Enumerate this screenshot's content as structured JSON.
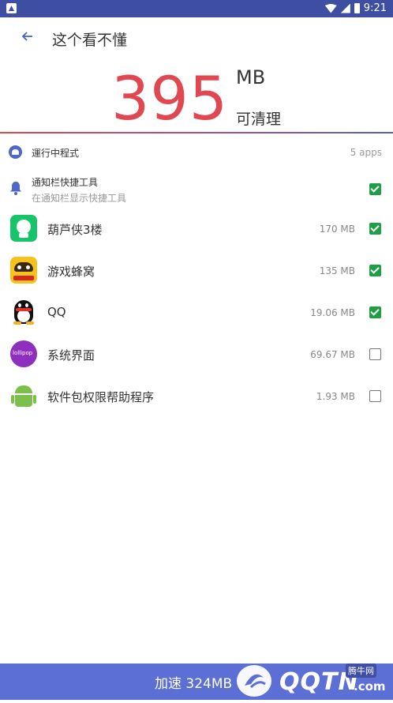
{
  "status": {
    "time": "9:21"
  },
  "header": {
    "title": "这个看不懂"
  },
  "summary": {
    "amount": "395",
    "unit": "MB",
    "label": "可清理"
  },
  "running": {
    "label": "運行中程式",
    "count": "5 apps"
  },
  "notify": {
    "title": "通知栏快捷工具",
    "subtitle": "在通知栏显示快捷工具",
    "checked": true
  },
  "apps": [
    {
      "name": "葫芦侠3楼",
      "size": "170 MB",
      "checked": true,
      "icon": "huluxia-icon"
    },
    {
      "name": "游戏蜂窝",
      "size": "135 MB",
      "checked": true,
      "icon": "youxifengwo-icon"
    },
    {
      "name": "QQ",
      "size": "19.06 MB",
      "checked": true,
      "icon": "qq-penguin-icon"
    },
    {
      "name": "系统界面",
      "size": "69.67 MB",
      "checked": false,
      "icon": "lollipop-icon"
    },
    {
      "name": "软件包权限帮助程序",
      "size": "1.93 MB",
      "checked": false,
      "icon": "android-icon"
    }
  ],
  "footer": {
    "action": "加速 324MB"
  },
  "watermark": {
    "brand": "QQTN",
    "domain_suffix": ".com",
    "tag": "腾牛网"
  },
  "colors": {
    "accent": "#3e4fa3",
    "number": "#e04750",
    "check": "#1f9f45",
    "bottom": "#5b6fd5"
  }
}
